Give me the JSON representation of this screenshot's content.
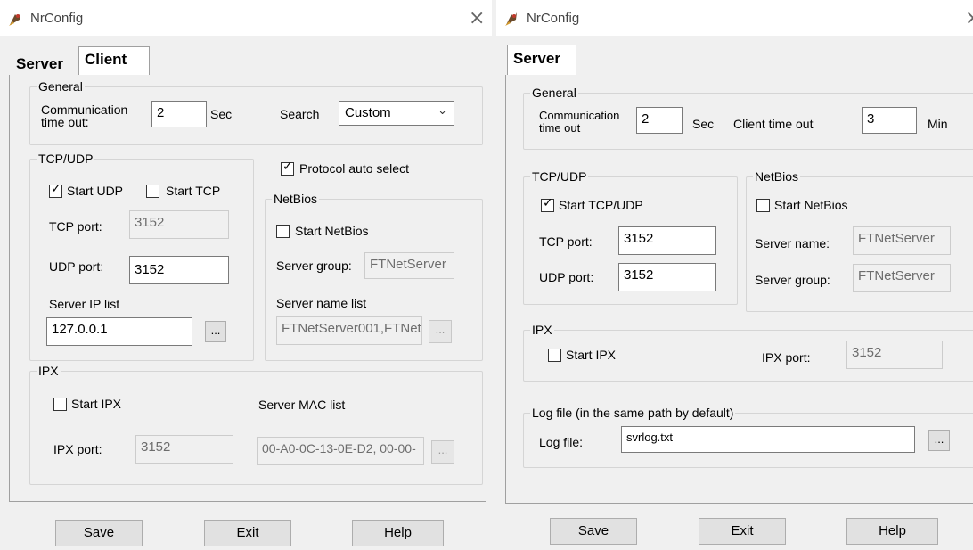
{
  "client_window": {
    "title": "NrConfig",
    "close_glyph": "×",
    "tabs": [
      {
        "label": "Server",
        "active": false
      },
      {
        "label": "Client",
        "active": true
      }
    ],
    "general": {
      "group_label": "General",
      "comm_timeout_label": "Communication time out:",
      "comm_timeout_value": "2",
      "comm_timeout_unit": "Sec",
      "search_label": "Search",
      "search_value": "Custom"
    },
    "tcpudp": {
      "group_label": "TCP/UDP",
      "start_udp_label": "Start UDP",
      "start_udp_checked": true,
      "start_tcp_label": "Start TCP",
      "start_tcp_checked": false,
      "tcp_port_label": "TCP port:",
      "tcp_port_value": "3152",
      "udp_port_label": "UDP port:",
      "udp_port_value": "3152",
      "server_ip_list_label": "Server IP list",
      "server_ip_list_value": "127.0.0.1",
      "browse_label": "..."
    },
    "protocol_auto_select_label": "Protocol auto select",
    "protocol_auto_select_checked": true,
    "netbios": {
      "group_label": "NetBios",
      "start_netbios_label": "Start NetBios",
      "start_netbios_checked": false,
      "server_group_label": "Server group:",
      "server_group_value": "FTNetServer",
      "server_name_list_label": "Server name list",
      "server_name_list_value": "FTNetServer001,FTNet",
      "browse_label": "..."
    },
    "ipx": {
      "group_label": "IPX",
      "start_ipx_label": "Start IPX",
      "start_ipx_checked": false,
      "server_mac_list_label": "Server MAC list",
      "ipx_port_label": "IPX port:",
      "ipx_port_value": "3152",
      "server_mac_list_value": "00-A0-0C-13-0E-D2, 00-00-",
      "browse_label": "..."
    },
    "buttons": {
      "save": "Save",
      "exit": "Exit",
      "help": "Help"
    }
  },
  "server_window": {
    "title": "NrConfig",
    "close_glyph": "×",
    "tabs": [
      {
        "label": "Server",
        "active": true
      }
    ],
    "general": {
      "group_label": "General",
      "comm_timeout_label": "Communication time out",
      "comm_timeout_value": "2",
      "comm_timeout_unit": "Sec",
      "client_timeout_label": "Client time out",
      "client_timeout_value": "3",
      "client_timeout_unit": "Min"
    },
    "tcpudp": {
      "group_label": "TCP/UDP",
      "start_tcpudp_label": "Start TCP/UDP",
      "start_tcpudp_checked": true,
      "tcp_port_label": "TCP port:",
      "tcp_port_value": "3152",
      "udp_port_label": "UDP port:",
      "udp_port_value": "3152"
    },
    "netbios": {
      "group_label": "NetBios",
      "start_netbios_label": "Start NetBios",
      "start_netbios_checked": false,
      "server_name_label": "Server name:",
      "server_name_value": "FTNetServer",
      "server_group_label": "Server group:",
      "server_group_value": "FTNetServer"
    },
    "ipx": {
      "group_label": "IPX",
      "start_ipx_label": "Start IPX",
      "start_ipx_checked": false,
      "ipx_port_label": "IPX port:",
      "ipx_port_value": "3152"
    },
    "log": {
      "group_label": "Log file (in the same path by default)",
      "log_file_label": "Log file:",
      "log_file_value": "svrlog.txt",
      "browse_label": "..."
    },
    "buttons": {
      "save": "Save",
      "exit": "Exit",
      "help": "Help"
    }
  },
  "colors": {
    "window_bg": "#f0f0f0",
    "titlebar_bg": "#ffffff",
    "button_bg": "#e1e1e1",
    "disabled_text": "#6d6d6d"
  },
  "icons": {
    "app_icon": "nrconfig-app-icon",
    "dropdown_arrow": "chevron-down-icon",
    "check_mark": "check-icon"
  }
}
